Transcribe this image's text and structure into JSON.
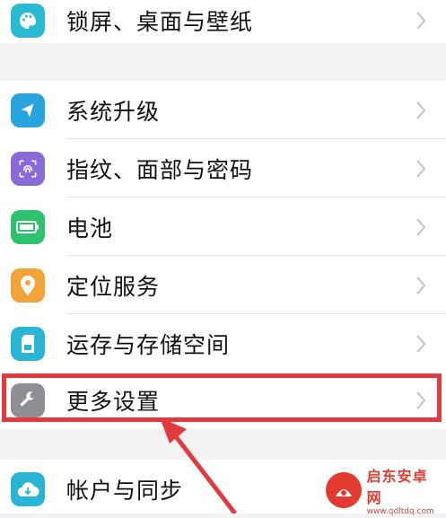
{
  "rows": [
    {
      "label": "锁屏、桌面与壁纸",
      "icon": "palette-icon",
      "color": "#2bbad4"
    },
    {
      "label": "系统升级",
      "icon": "update-icon",
      "color": "#2aa4df"
    },
    {
      "label": "指纹、面部与密码",
      "icon": "fingerprint-icon",
      "color": "#8a6ad9"
    },
    {
      "label": "电池",
      "icon": "battery-icon",
      "color": "#2fc26e"
    },
    {
      "label": "定位服务",
      "icon": "location-icon",
      "color": "#f2a43a"
    },
    {
      "label": "运存与存储空间",
      "icon": "storage-icon",
      "color": "#2ab5d4"
    },
    {
      "label": "更多设置",
      "icon": "wrench-icon",
      "color": "#8e8e94"
    },
    {
      "label": "帐户与同步",
      "icon": "cloud-sync-icon",
      "color": "#29b4d6"
    }
  ],
  "highlight_color": "#e23a3e",
  "watermark": {
    "title": "启东安卓网",
    "url": "www.qdltdq.com"
  }
}
